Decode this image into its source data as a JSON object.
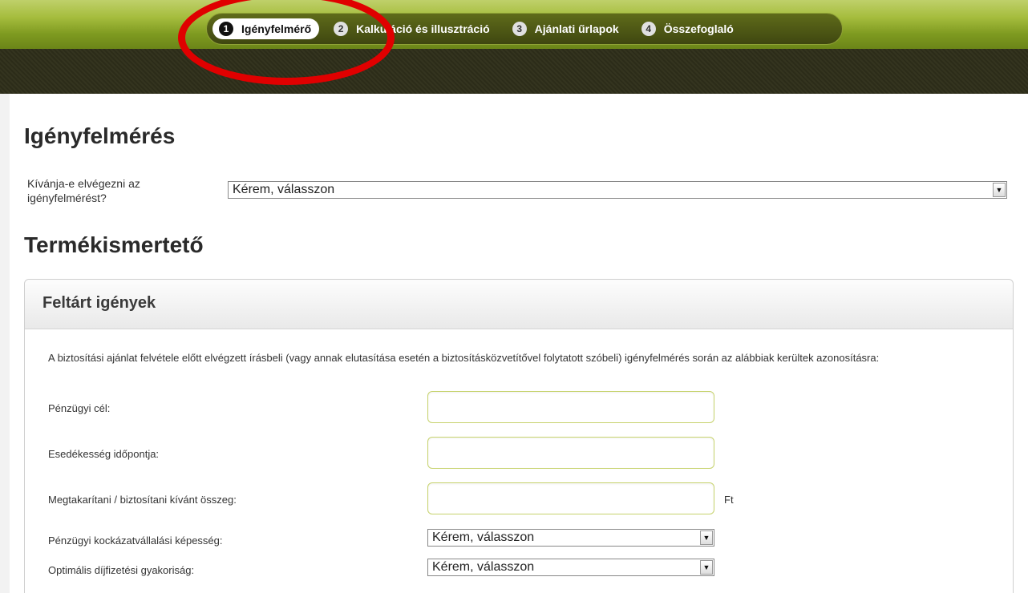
{
  "steps": [
    {
      "num": "1",
      "label": "Igényfelmérő",
      "active": true
    },
    {
      "num": "2",
      "label": "Kalkuláció és illusztráció"
    },
    {
      "num": "3",
      "label": "Ajánlati űrlapok"
    },
    {
      "num": "4",
      "label": "Összefoglaló"
    }
  ],
  "needs_section": {
    "title": "Igényfelmérés",
    "question": "Kívánja-e elvégezni az igényfelmérést?",
    "select_value": "Kérem, válasszon"
  },
  "product_section": {
    "title": "Termékismertető"
  },
  "panel": {
    "title": "Feltárt igények",
    "intro": "A biztosítási ajánlat felvétele előtt elvégzett írásbeli (vagy annak elutasítása esetén a biztosításközvetítővel folytatott szóbeli) igényfelmérés során az alábbiak kerültek azonosításra:",
    "fields": {
      "financial_goal": "Pénzügyi cél:",
      "due_date": "Esedékesség időpontja:",
      "amount": "Megtakarítani / biztosítani kívánt összeg:",
      "amount_unit": "Ft",
      "risk": "Pénzügyi kockázatvállalási képesség:",
      "risk_value": "Kérem, válasszon",
      "frequency": "Optimális díjfizetési gyakoriság:",
      "frequency_value": "Kérem, válasszon"
    }
  },
  "colors": {
    "accent_green": "#a6bd3e",
    "annotation_red": "#e00000"
  }
}
